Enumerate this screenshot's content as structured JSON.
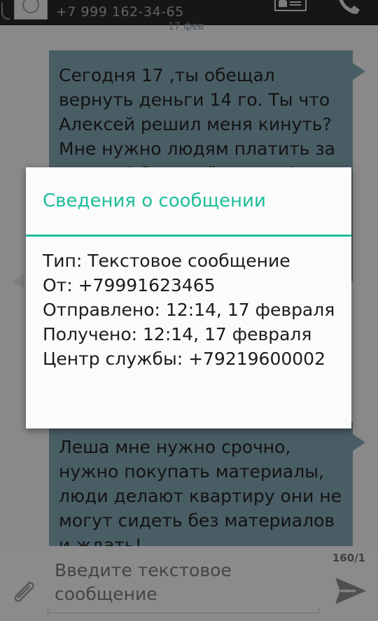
{
  "header": {
    "phone_number": "+7 999 162-34-65",
    "date_label": "17 фев"
  },
  "conversation": {
    "messages": [
      {
        "text": "Сегодня 17 ,ты обещал вернуть деньги 14 го. Ты что Алексей решил меня кинуть? Мне нужно людям платить за ремонт! Отдавай деньги!"
      },
      {
        "text": "Леша мне нужно срочно, нужно покупать материалы, люди делают квартиру они не могут сидеть без материалов и ждать!"
      }
    ]
  },
  "dialog": {
    "title": "Сведения о сообщении",
    "lines": {
      "type": "Тип: Текстовое сообщение",
      "from": "От: +79991623465",
      "sent": "Отправлено: 12:14, 17 февраля",
      "received": "Получено: 12:14, 17 февраля",
      "service_center": "Центр службы: +79219600002"
    }
  },
  "compose": {
    "char_count": "160/1",
    "placeholder": "Введите текстовое сообщение"
  },
  "colors": {
    "accent": "#1ebe9a",
    "bubble": "#7fa0ac",
    "header_bg": "#262626"
  },
  "icons": {
    "back": "back-arrow-icon",
    "avatar": "contact-avatar-icon",
    "contact_card": "contact-card-icon",
    "call": "phone-call-icon",
    "attach": "paperclip-icon",
    "send": "send-icon"
  }
}
